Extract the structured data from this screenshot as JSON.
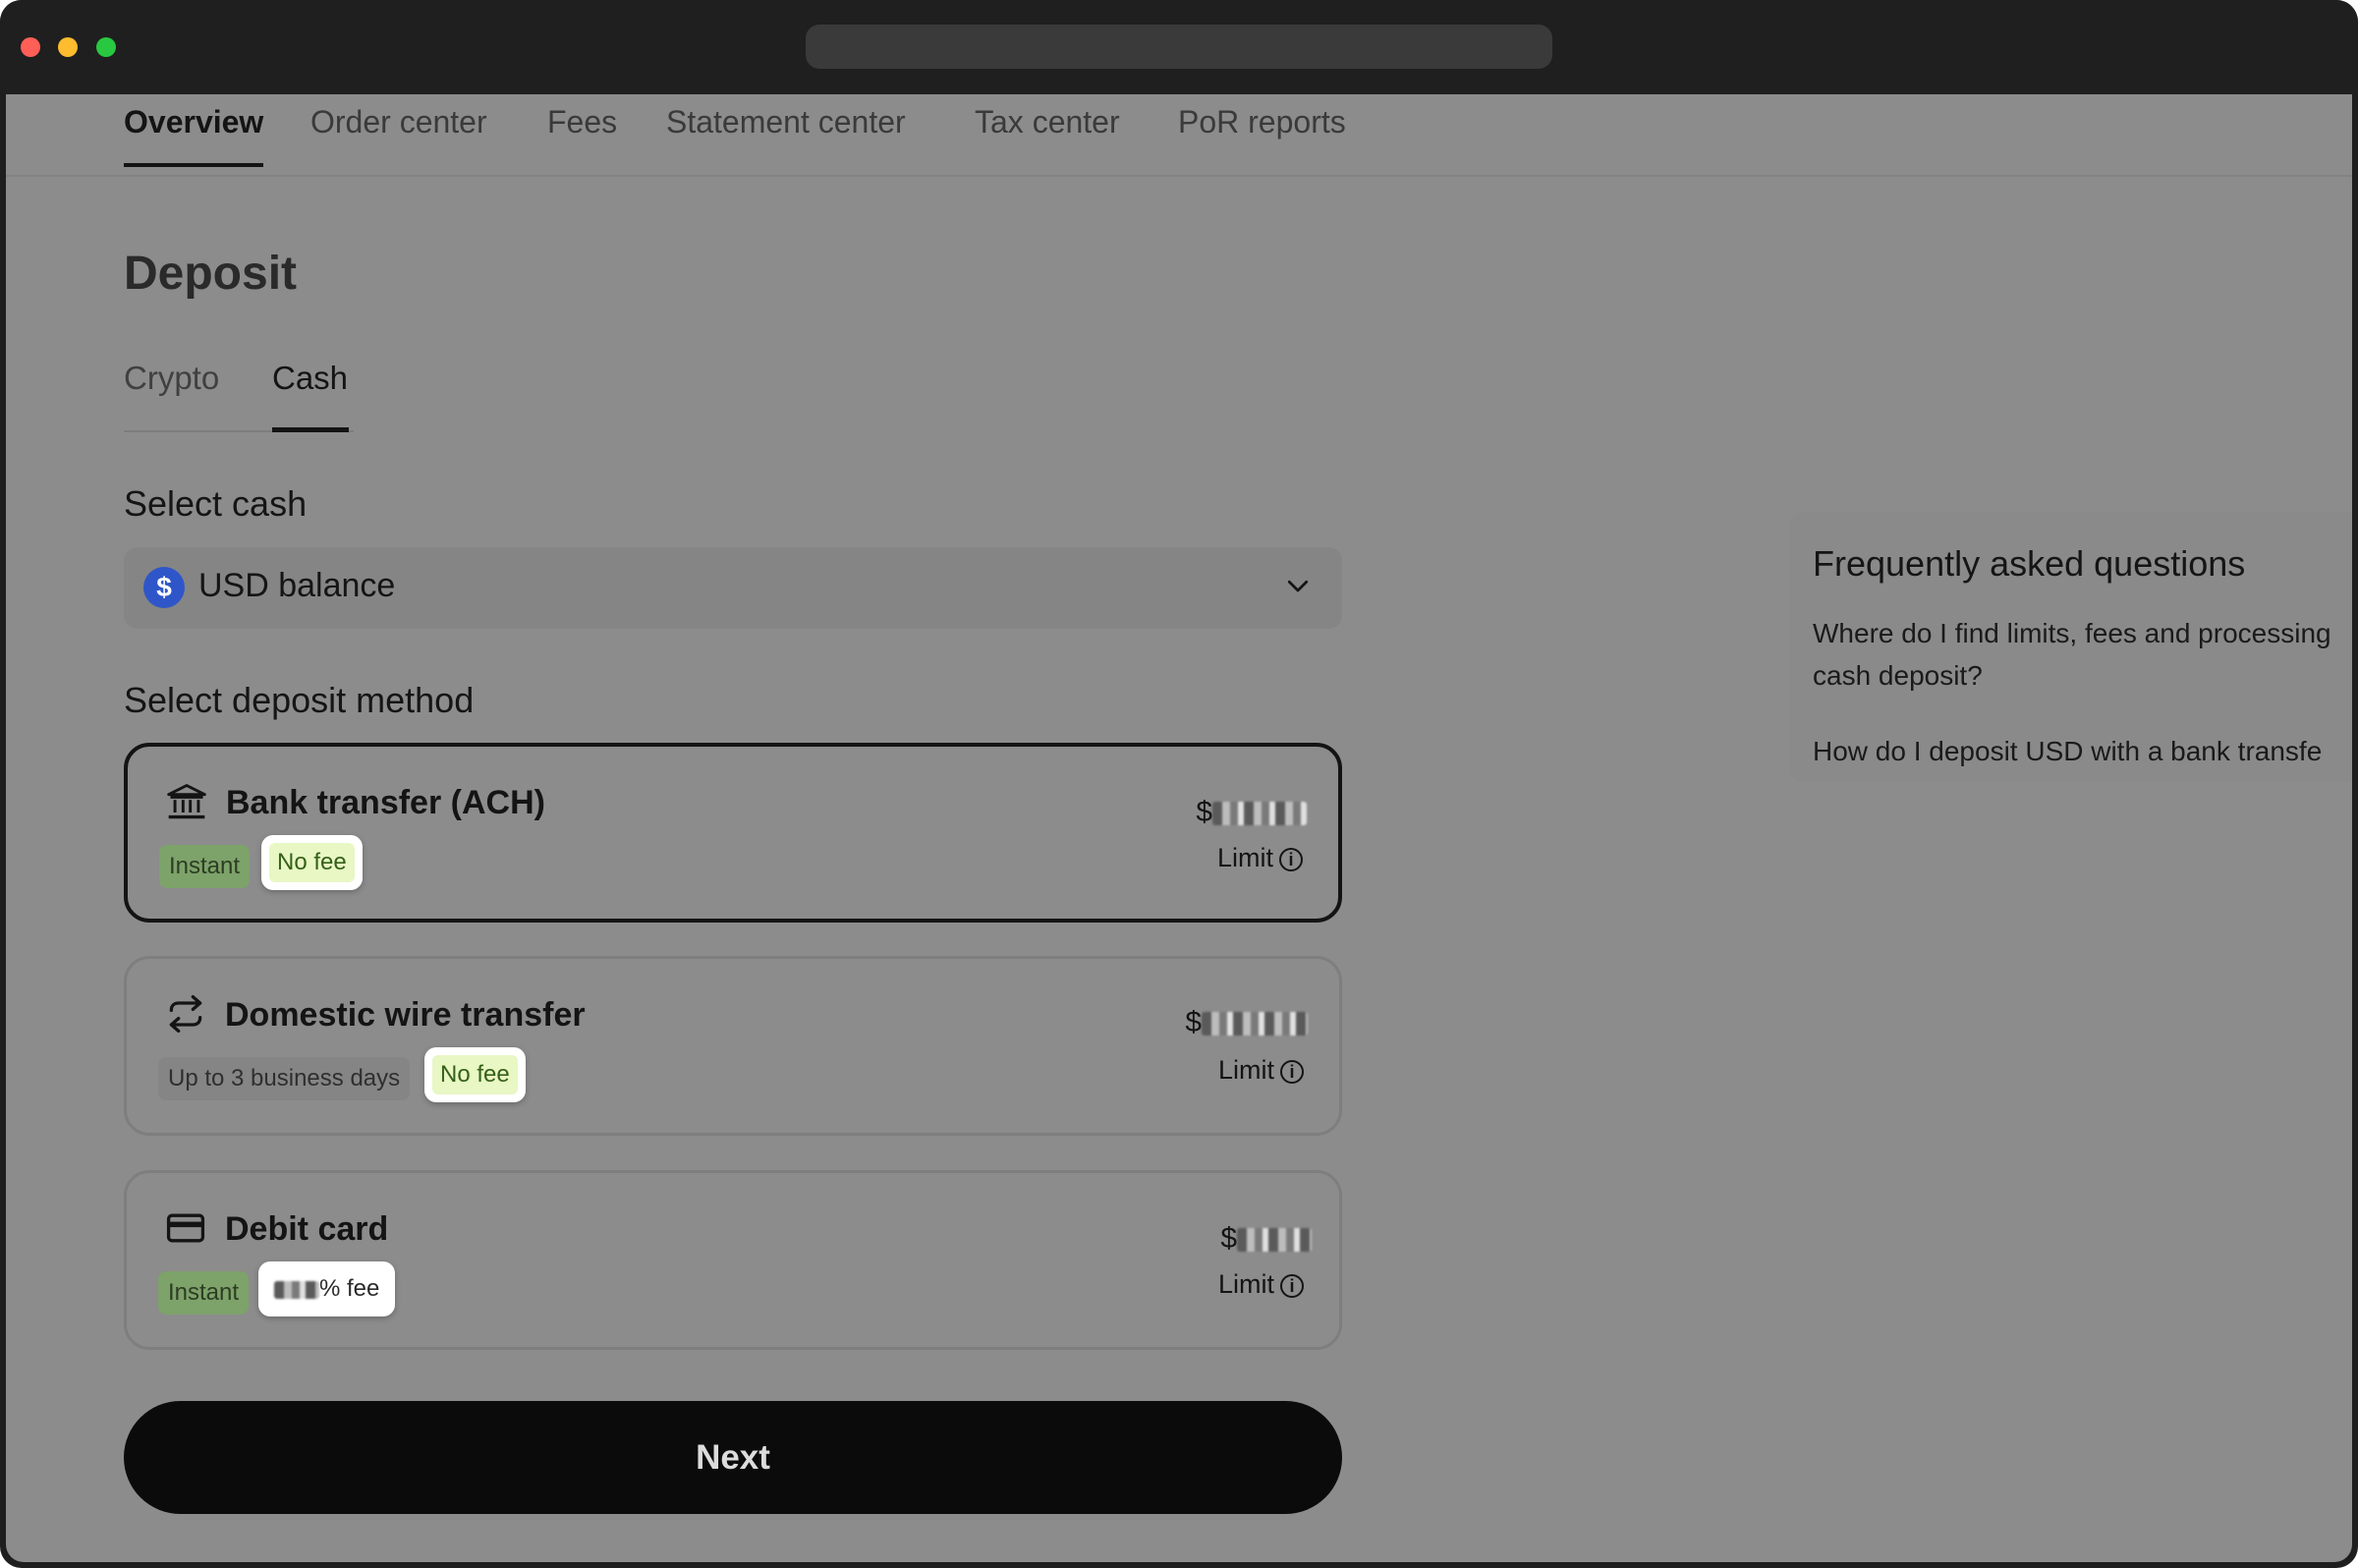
{
  "nav": {
    "tabs": [
      {
        "label": "Overview",
        "active": true
      },
      {
        "label": "Order center"
      },
      {
        "label": "Fees"
      },
      {
        "label": "Statement center"
      },
      {
        "label": "Tax center"
      },
      {
        "label": "PoR reports"
      }
    ]
  },
  "page": {
    "title": "Deposit"
  },
  "subtabs": [
    {
      "label": "Crypto"
    },
    {
      "label": "Cash",
      "active": true
    }
  ],
  "select_cash": {
    "label": "Select cash",
    "value": "USD balance",
    "icon": "dollar-coin-icon",
    "icon_glyph": "$"
  },
  "deposit_method": {
    "label": "Select deposit method",
    "methods": [
      {
        "title": "Bank transfer (ACH)",
        "icon": "bank-icon",
        "speed": "Instant",
        "fee": "No fee",
        "amount_prefix": "$",
        "limit_label": "Limit",
        "selected": true
      },
      {
        "title": "Domestic wire transfer",
        "icon": "transfer-arrows-icon",
        "speed": "Up to 3 business days",
        "fee": "No fee",
        "amount_prefix": "$",
        "limit_label": "Limit"
      },
      {
        "title": "Debit card",
        "icon": "credit-card-icon",
        "speed": "Instant",
        "fee": "% fee",
        "amount_prefix": "$",
        "limit_label": "Limit"
      }
    ]
  },
  "next_button": {
    "label": "Next"
  },
  "faq": {
    "title": "Frequently asked questions",
    "items": [
      "Where do I find limits, fees and processing cash deposit?",
      "How do I deposit USD with a bank transfe"
    ]
  },
  "colors": {
    "accent_dark": "#141414",
    "fee_badge": "#e8f7c4",
    "speed_badge": "#7da26a",
    "usd_icon": "#2f56c8"
  }
}
